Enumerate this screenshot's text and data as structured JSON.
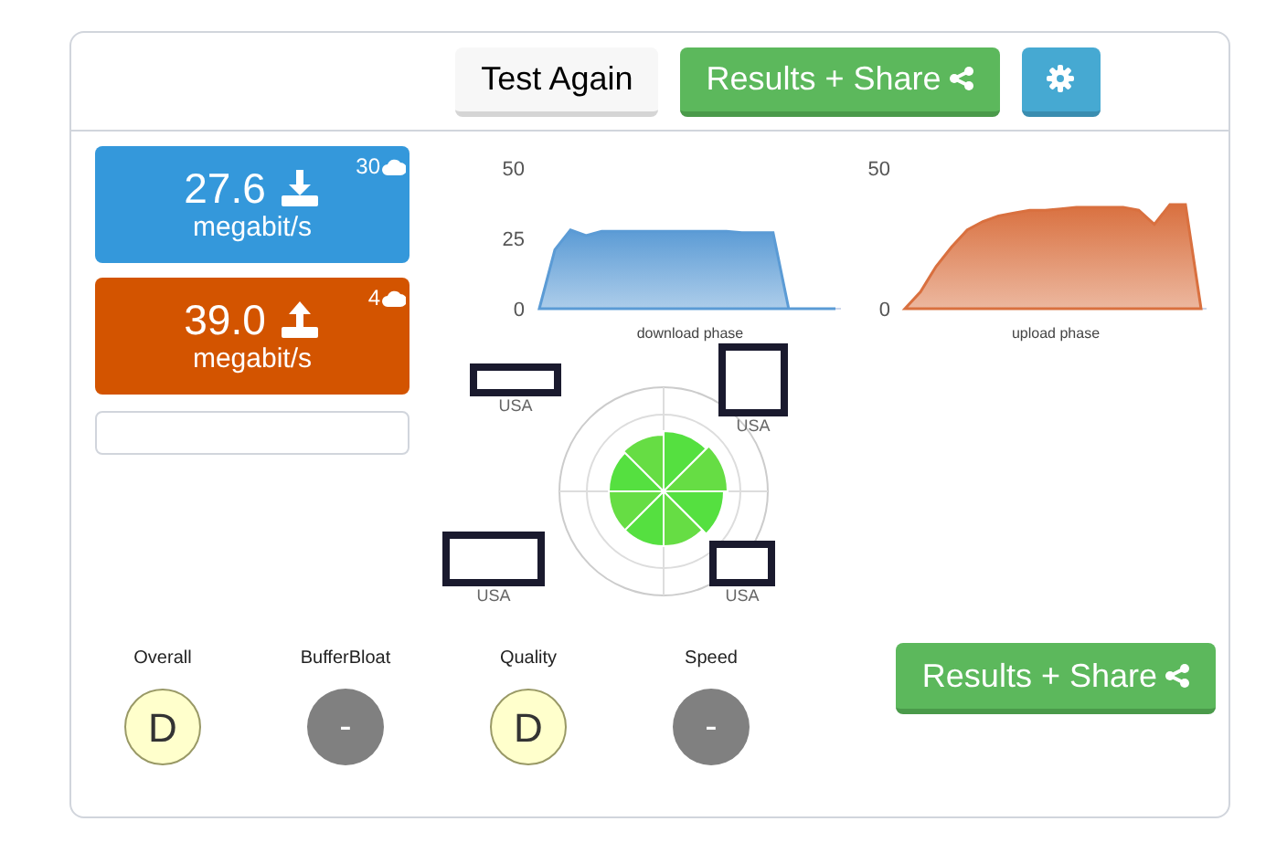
{
  "toolbar": {
    "buttons": [
      {
        "kind": "plain",
        "label": "Test Again"
      },
      {
        "kind": "share",
        "label": "Results + Share"
      },
      {
        "kind": "settings"
      }
    ]
  },
  "speeds": [
    {
      "kind": "download",
      "value": "27.6",
      "unit": "megabit/s",
      "count": "30"
    },
    {
      "kind": "upload",
      "value": "39.0",
      "unit": "megabit/s",
      "count": "4"
    }
  ],
  "charts": [
    {
      "chart_data": {
        "type": "area",
        "xlabel": "download phase",
        "ylim": [
          0,
          50
        ],
        "yticks": [
          0,
          25,
          50
        ],
        "series": [
          {
            "color": "#5b9bd5",
            "values": [
              0,
              21,
              28,
              26,
              27.5,
              27.5,
              27.5,
              27.5,
              27.5,
              27.5,
              27.5,
              27.5,
              27.5,
              27,
              27,
              27,
              0,
              0,
              0,
              0
            ]
          }
        ]
      }
    },
    {
      "chart_data": {
        "type": "area",
        "xlabel": "upload phase",
        "ylim": [
          0,
          50
        ],
        "yticks": [
          0,
          50
        ],
        "series": [
          {
            "color": "#d9703f",
            "values": [
              0,
              6,
              15,
              22,
              28,
              31,
              33,
              34,
              35,
              35,
              35.5,
              36,
              36,
              36,
              36,
              35,
              30,
              37,
              37,
              0
            ]
          }
        ]
      }
    }
  ],
  "servers": [
    {
      "label": "USA"
    },
    {
      "label": "USA"
    },
    {
      "label": "USA"
    },
    {
      "label": "USA"
    }
  ],
  "grades": [
    {
      "label": "Overall",
      "grade": "D",
      "kind": "grade"
    },
    {
      "label": "BufferBloat",
      "grade": "-",
      "kind": "none"
    },
    {
      "label": "Quality",
      "grade": "D",
      "kind": "grade"
    },
    {
      "label": "Speed",
      "grade": "-",
      "kind": "none"
    }
  ],
  "share_button": {
    "label": "Results + Share"
  }
}
